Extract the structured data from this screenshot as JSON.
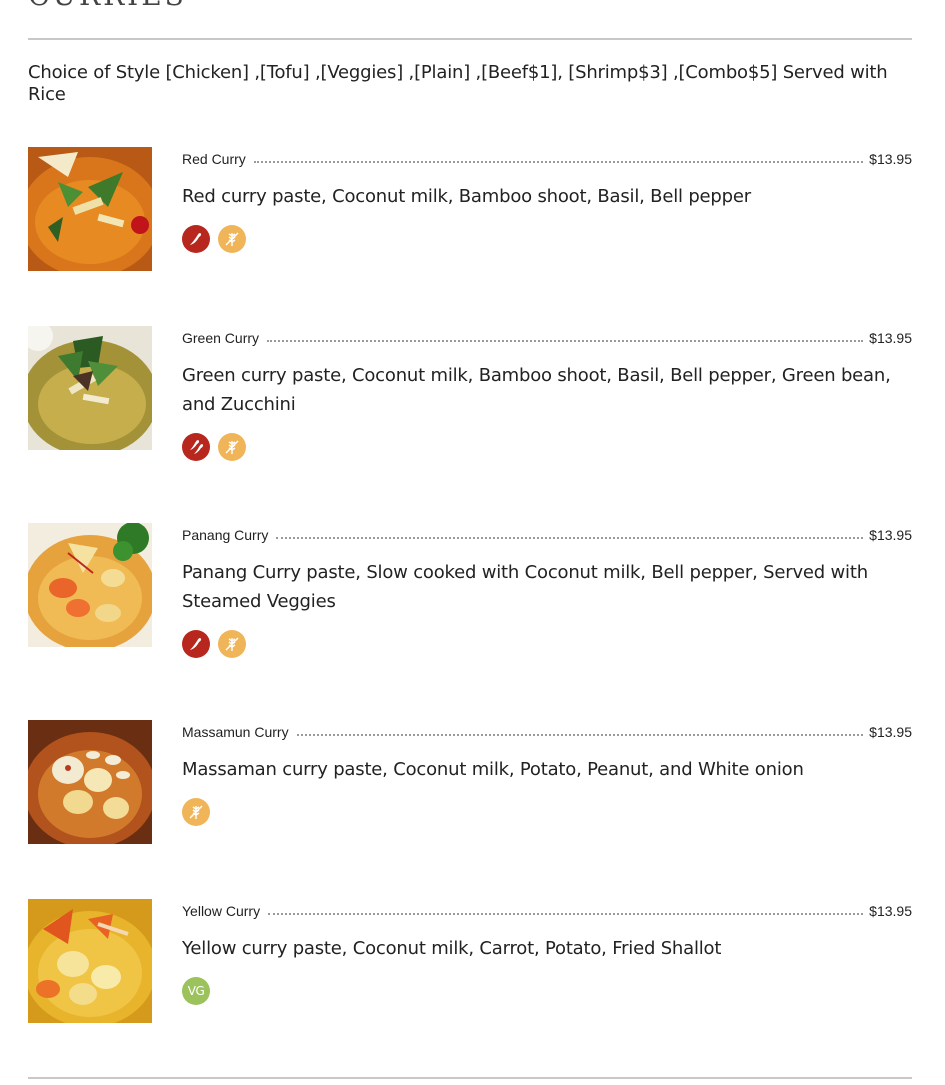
{
  "section": {
    "title": "Curries",
    "intro": "Choice of Style [Chicken] ,[Tofu] ,[Veggies] ,[Plain] ,[Beef$1], [Shrimp$3] ,[Combo$5] Served with Rice"
  },
  "items": [
    {
      "name": "Red Curry",
      "price": "$13.95",
      "description": "Red curry paste, Coconut milk, Bamboo shoot, Basil, Bell pepper",
      "icons": [
        "chili-pepper-icon",
        "gluten-free-icon"
      ]
    },
    {
      "name": "Green Curry",
      "price": "$13.95",
      "description": "Green curry paste, Coconut milk, Bamboo shoot, Basil, Bell pepper, Green bean, and Zucchini",
      "icons": [
        "double-chili-pepper-icon",
        "gluten-free-icon"
      ]
    },
    {
      "name": "Panang Curry",
      "price": "$13.95",
      "description": "Panang Curry paste, Slow cooked with Coconut milk, Bell pepper, Served with Steamed Veggies",
      "icons": [
        "chili-pepper-icon",
        "gluten-free-icon"
      ]
    },
    {
      "name": "Massamun Curry",
      "price": "$13.95",
      "description": "Massaman curry paste, Coconut milk, Potato, Peanut, and White onion",
      "icons": [
        "gluten-free-icon"
      ]
    },
    {
      "name": "Yellow Curry",
      "price": "$13.95",
      "description": "Yellow curry paste, Coconut milk, Carrot, Potato, Fried Shallot",
      "icons": [
        "vegan-icon"
      ],
      "vegan_label": "VG"
    }
  ],
  "colors": {
    "spicy": "#b8271d",
    "gluten_free": "#efb558",
    "vegan": "#9bc25b",
    "rule": "#c8c8c8"
  }
}
